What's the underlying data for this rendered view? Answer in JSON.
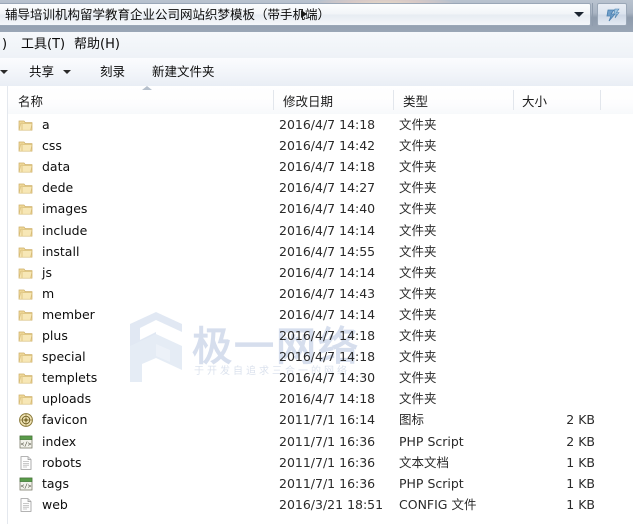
{
  "window": {
    "address_bar": {
      "path_text": "辅导培训机构留学教育企业公司网站织梦模板（带手机端）",
      "dropdown_icon": "chevron-down-icon",
      "crumb_icon": "chevron-right-icon",
      "refresh_label": "",
      "refresh_icon": "refresh-icon"
    },
    "menubar": {
      "items": [
        {
          "label": ")"
        },
        {
          "label": "工具(T)"
        },
        {
          "label": "帮助(H)"
        }
      ]
    },
    "toolbar": {
      "items": [
        {
          "label": "共享",
          "has_caret": true
        },
        {
          "label": "刻录",
          "has_caret": false
        },
        {
          "label": "新建文件夹",
          "has_caret": false
        }
      ]
    }
  },
  "filelist": {
    "columns": [
      {
        "label": "名称",
        "sorted": "asc"
      },
      {
        "label": "修改日期"
      },
      {
        "label": "类型"
      },
      {
        "label": "大小"
      }
    ],
    "rows": [
      {
        "name": "a",
        "date": "2016/4/7 14:18",
        "type": "文件夹",
        "size": "",
        "icon": "folder-icon"
      },
      {
        "name": "css",
        "date": "2016/4/7 14:42",
        "type": "文件夹",
        "size": "",
        "icon": "folder-icon"
      },
      {
        "name": "data",
        "date": "2016/4/7 14:18",
        "type": "文件夹",
        "size": "",
        "icon": "folder-icon"
      },
      {
        "name": "dede",
        "date": "2016/4/7 14:27",
        "type": "文件夹",
        "size": "",
        "icon": "folder-icon"
      },
      {
        "name": "images",
        "date": "2016/4/7 14:40",
        "type": "文件夹",
        "size": "",
        "icon": "folder-icon"
      },
      {
        "name": "include",
        "date": "2016/4/7 14:14",
        "type": "文件夹",
        "size": "",
        "icon": "folder-icon"
      },
      {
        "name": "install",
        "date": "2016/4/7 14:55",
        "type": "文件夹",
        "size": "",
        "icon": "folder-icon"
      },
      {
        "name": "js",
        "date": "2016/4/7 14:14",
        "type": "文件夹",
        "size": "",
        "icon": "folder-icon"
      },
      {
        "name": "m",
        "date": "2016/4/7 14:43",
        "type": "文件夹",
        "size": "",
        "icon": "folder-icon"
      },
      {
        "name": "member",
        "date": "2016/4/7 14:14",
        "type": "文件夹",
        "size": "",
        "icon": "folder-icon"
      },
      {
        "name": "plus",
        "date": "2016/4/7 14:18",
        "type": "文件夹",
        "size": "",
        "icon": "folder-icon"
      },
      {
        "name": "special",
        "date": "2016/4/7 14:18",
        "type": "文件夹",
        "size": "",
        "icon": "folder-icon"
      },
      {
        "name": "templets",
        "date": "2016/4/7 14:30",
        "type": "文件夹",
        "size": "",
        "icon": "folder-icon"
      },
      {
        "name": "uploads",
        "date": "2016/4/7 14:18",
        "type": "文件夹",
        "size": "",
        "icon": "folder-icon"
      },
      {
        "name": "favicon",
        "date": "2011/7/1 16:14",
        "type": "图标",
        "size": "2 KB",
        "icon": "favicon-icon"
      },
      {
        "name": "index",
        "date": "2011/7/1 16:36",
        "type": "PHP Script",
        "size": "2 KB",
        "icon": "php-file-icon"
      },
      {
        "name": "robots",
        "date": "2011/7/1 16:36",
        "type": "文本文档",
        "size": "1 KB",
        "icon": "text-file-icon"
      },
      {
        "name": "tags",
        "date": "2011/7/1 16:36",
        "type": "PHP Script",
        "size": "1 KB",
        "icon": "php-file-icon"
      },
      {
        "name": "web",
        "date": "2016/3/21 18:51",
        "type": "CONFIG 文件",
        "size": "1 KB",
        "icon": "text-file-icon"
      }
    ]
  },
  "watermark": {
    "text": "极一网络",
    "subtext": "于开发自追求三合一的网络",
    "color": "#7b93c4"
  },
  "colors": {
    "titlebar": "#9aa6b6",
    "toolbar": "#f1f4f9",
    "list_background": "#ffffff",
    "folder_icon": "#e3c579",
    "accent": "#7b93c4"
  }
}
